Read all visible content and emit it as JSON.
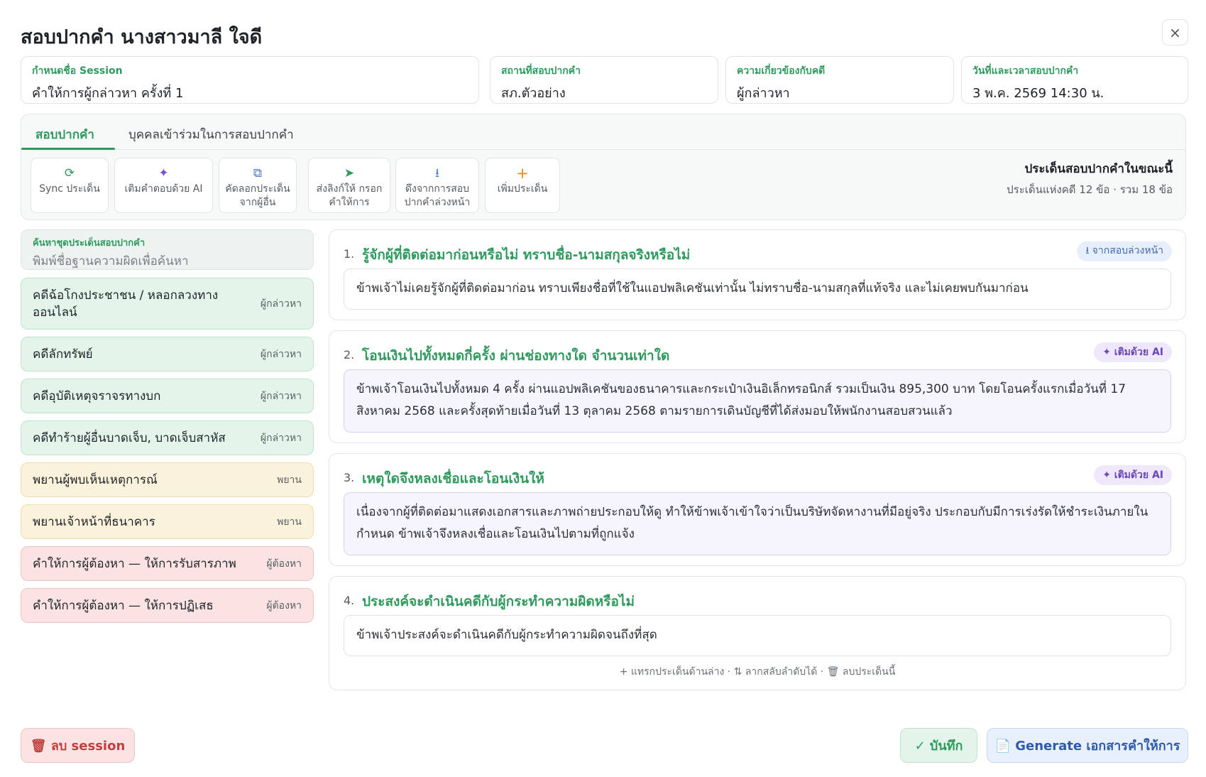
{
  "dialog": {
    "title": "สอบปากคำ นางสาวมาลี ใจดี",
    "close_icon": "×"
  },
  "fields": [
    {
      "label": "กำหนดชื่อ Session",
      "value": "คำให้การผู้กล่าวหา ครั้งที่ 1"
    },
    {
      "label": "สถานที่สอบปากคำ",
      "value": "สภ.ตัวอย่าง"
    },
    {
      "label": "ความเกี่ยวข้องกับคดี",
      "value": "ผู้กล่าวหา"
    },
    {
      "label": "วันที่และเวลาสอบปากคำ",
      "value": "3 พ.ค. 2569 14:30 น."
    }
  ],
  "tabs": [
    {
      "label": "สอบปากคำ",
      "active": true
    },
    {
      "label": "บุคคลเข้าร่วมในการสอบปากคำ",
      "active": false
    }
  ],
  "toolbar": [
    {
      "icon": "sync-icon",
      "glyph": "⟳",
      "color": "#2f9a5e",
      "label": "Sync ประเด็น"
    },
    {
      "icon": "sparkle-icon",
      "glyph": "✦",
      "color": "#7b4fd0",
      "label": "เติมคำตอบด้วย AI"
    },
    {
      "icon": "copy-icon",
      "glyph": "⧉",
      "color": "#4a78c8",
      "label": "คัดลอกประเด็น จากผู้อื่น"
    },
    {
      "icon": "send-icon",
      "glyph": "➤",
      "color": "#2f9a5e",
      "label": "ส่งลิงก์ให้ กรอกคำให้การ"
    },
    {
      "icon": "download-icon",
      "glyph": "⭳",
      "color": "#4a78c8",
      "label": "ดึงจากการสอบ ปากคำล่วงหน้า"
    },
    {
      "icon": "plus-icon",
      "glyph": "+",
      "color": "#e08a1e",
      "label": "เพิ่มประเด็น"
    }
  ],
  "current_topics": {
    "title": "ประเด็นสอบปากคำในขณะนี้",
    "summary": "ประเด็นแห่งคดี 12 ข้อ · รวม 18 ข้อ"
  },
  "search": {
    "label": "ค้นหาชุดประเด็นสอบปากคำ",
    "placeholder": "พิมพ์ชื่อฐานความผิดเพื่อค้นหา"
  },
  "cases": [
    {
      "name": "คดีฉ้อโกงประชาชน / หลอกลวงทาง ออนไลน์",
      "tag": "ผู้กล่าวหา",
      "tone": "green"
    },
    {
      "name": "คดีลักทรัพย์",
      "tag": "ผู้กล่าวหา",
      "tone": "green"
    },
    {
      "name": "คดีอุบัติเหตุจราจรทางบก",
      "tag": "ผู้กล่าวหา",
      "tone": "green"
    },
    {
      "name": "คดีทำร้ายผู้อื่นบาดเจ็บ, บาดเจ็บสาหัส",
      "tag": "ผู้กล่าวหา",
      "tone": "green"
    },
    {
      "name": "พยานผู้พบเห็นเหตุการณ์",
      "tag": "พยาน",
      "tone": "yellow"
    },
    {
      "name": "พยานเจ้าหน้าที่ธนาคาร",
      "tag": "พยาน",
      "tone": "yellow"
    },
    {
      "name": "คำให้การผู้ต้องหา — ให้การรับสารภาพ",
      "tag": "ผู้ต้องหา",
      "tone": "red"
    },
    {
      "name": "คำให้การผู้ต้องหา — ให้การปฏิเสธ",
      "tag": "ผู้ต้องหา",
      "tone": "red"
    }
  ],
  "questions": [
    {
      "number": "1.",
      "text": "รู้จักผู้ที่ติดต่อมาก่อนหรือไม่ ทราบชื่อ-นามสกุลจริงหรือไม่",
      "badge": "⭳ จากสอบล่วงหน้า",
      "answer": "ข้าพเจ้าไม่เคยรู้จักผู้ที่ติดต่อมาก่อน ทราบเพียงชื่อที่ใช้ในแอปพลิเคชันเท่านั้น ไม่ทราบชื่อ-นามสกุลที่แท้จริง และไม่เคยพบกันมาก่อน"
    },
    {
      "number": "2.",
      "text": "โอนเงินไปทั้งหมดกี่ครั้ง ผ่านช่องทางใด จำนวนเท่าใด",
      "badge": "✦ เติมด้วย AI",
      "answer": "ข้าพเจ้าโอนเงินไปทั้งหมด 4 ครั้ง ผ่านแอปพลิเคชันของธนาคารและกระเป๋าเงินอิเล็กทรอนิกส์ รวมเป็นเงิน 895,300 บาท โดยโอนครั้งแรกเมื่อวันที่ 17 สิงหาคม 2568 และครั้งสุดท้ายเมื่อวันที่ 13 ตุลาคม 2568 ตามรายการเดินบัญชีที่ได้ส่งมอบให้พนักงานสอบสวนแล้ว"
    },
    {
      "number": "3.",
      "text": "เหตุใดจึงหลงเชื่อและโอนเงินให้",
      "badge": "✦ เติมด้วย AI",
      "answer": "เนื่องจากผู้ที่ติดต่อมาแสดงเอกสารและภาพถ่ายประกอบให้ดู ทำให้ข้าพเจ้าเข้าใจว่าเป็นบริษัทจัดหางานที่มีอยู่จริง ประกอบกับมีการเร่งรัดให้ชำระเงินภายในกำหนด ข้าพเจ้าจึงหลงเชื่อและโอนเงินไปตามที่ถูกแจ้ง"
    },
    {
      "number": "4.",
      "text": "ประสงค์จะดำเนินคดีกับผู้กระทำความผิดหรือไม่",
      "answer": "ข้าพเจ้าประสงค์จะดำเนินคดีกับผู้กระทำความผิดจนถึงที่สุด",
      "helper": "+ แทรกประเด็นด้านล่าง · ⇅ ลากสลับลำดับได้ · 🗑 ลบประเด็นนี้"
    }
  ],
  "footer": {
    "delete_label": "🗑 ลบ session",
    "save_label": "✓ บันทึก",
    "generate_label": "📄 Generate เอกสารคำให้การ"
  }
}
